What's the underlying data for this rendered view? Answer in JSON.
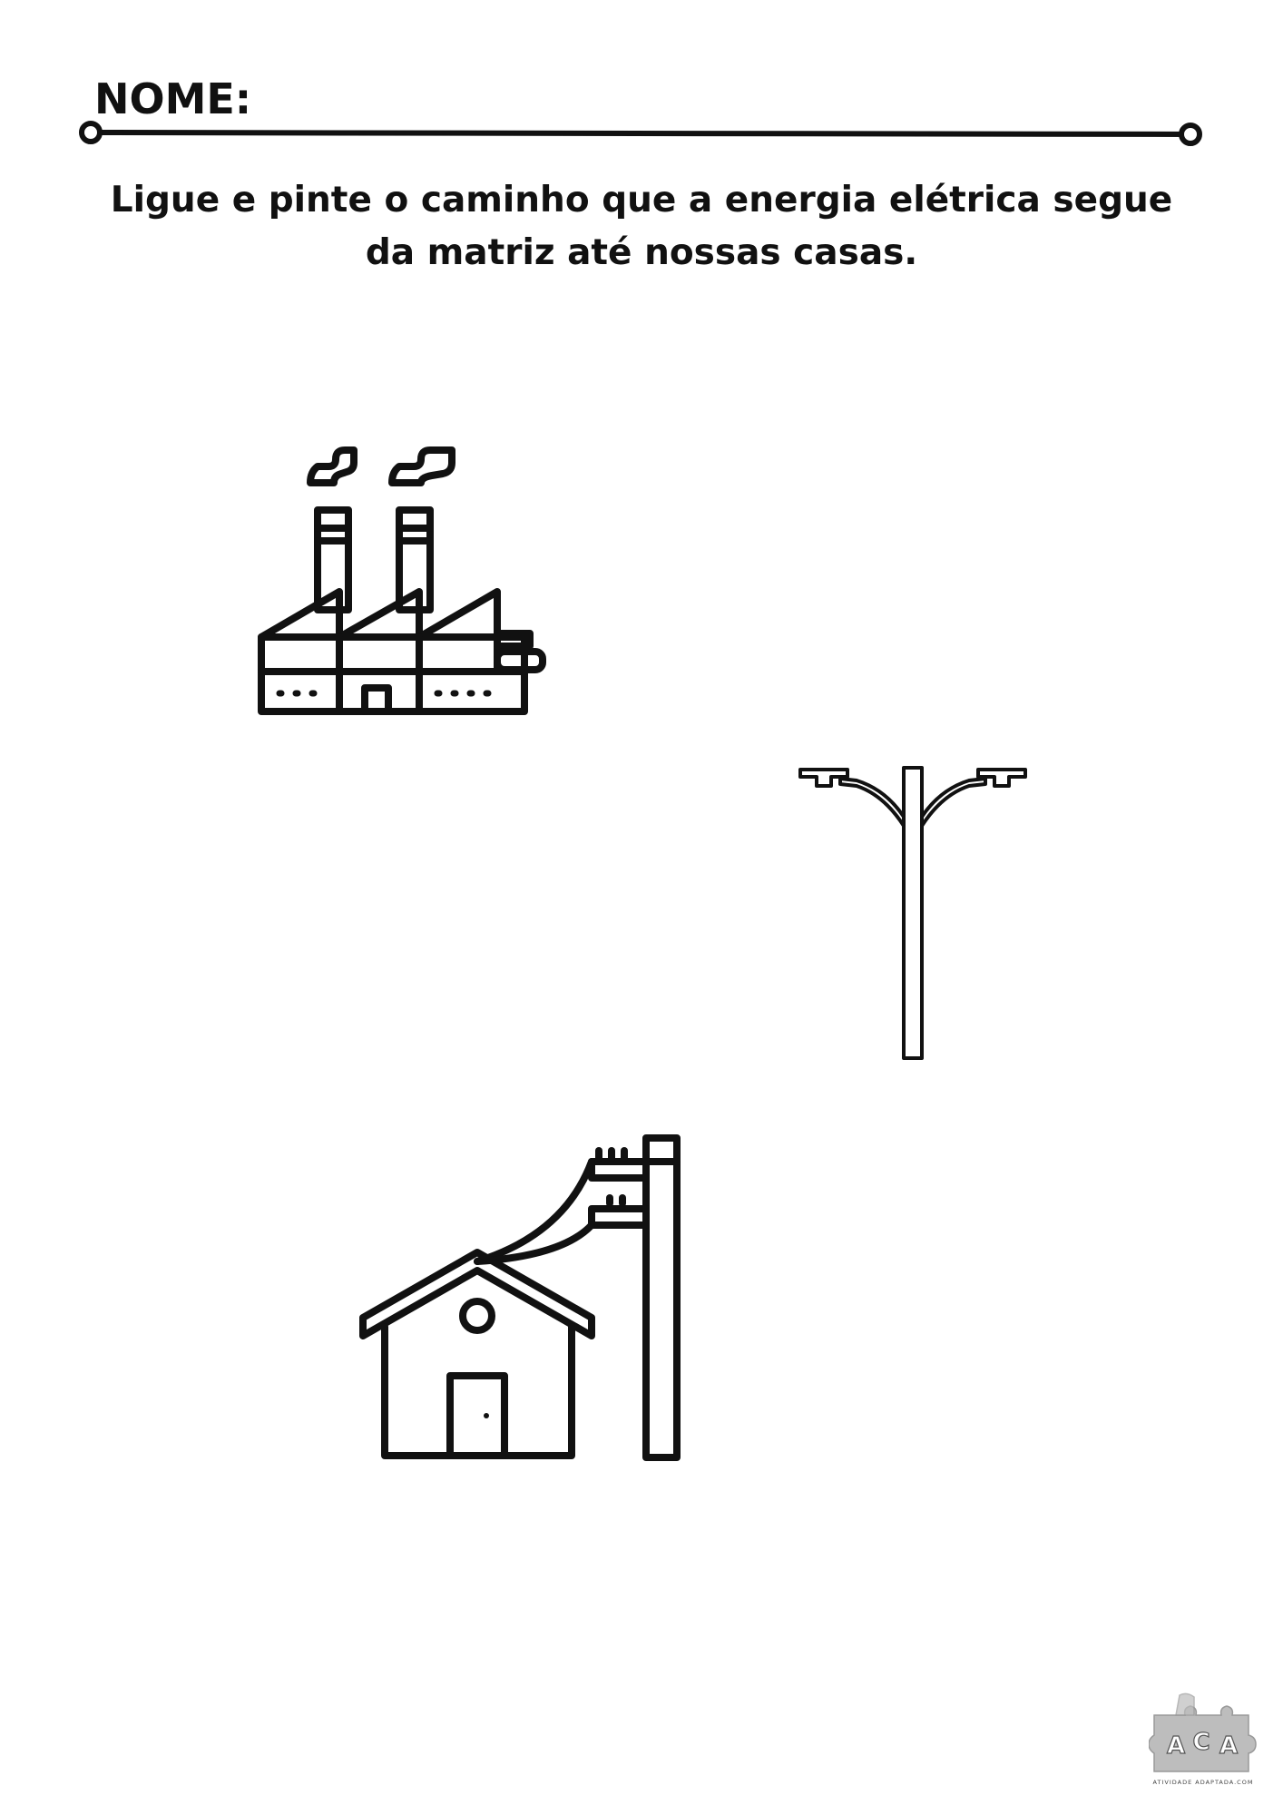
{
  "worksheet": {
    "name_label": "NOME:",
    "instruction_line1": "Ligue e pinte o caminho que a energia elétrica segue",
    "instruction_line2": "da matriz até nossas casas."
  },
  "illustrations": {
    "factory": "factory-icon",
    "street_lamp": "street-lamp-icon",
    "house_with_pole": "house-power-pole-icon"
  },
  "logo": {
    "letters": "ACA",
    "tagline": "ATIVIDADE ADAPTADA.COM"
  },
  "colors": {
    "ink": "#111111",
    "logo_gray": "#bdbdbd"
  }
}
